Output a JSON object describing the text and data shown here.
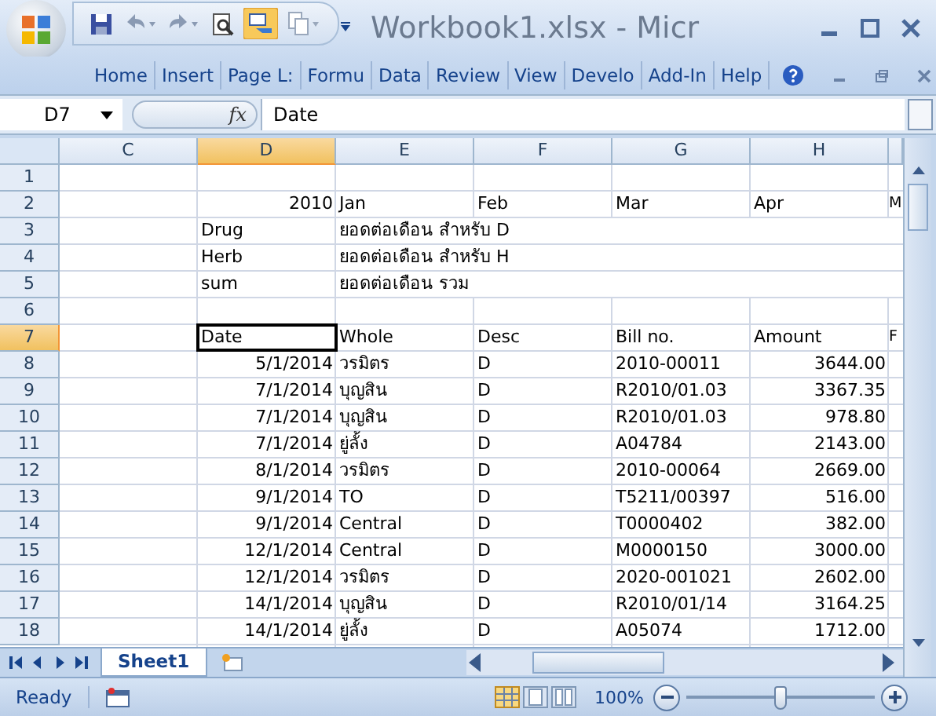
{
  "window": {
    "title": "Workbook1.xlsx - Micr"
  },
  "ribbon_tabs": [
    {
      "label": "Home",
      "selected": false
    },
    {
      "label": "Insert",
      "selected": false
    },
    {
      "label": "Page L:",
      "selected": false
    },
    {
      "label": "Formu",
      "selected": false
    },
    {
      "label": "Data",
      "selected": false
    },
    {
      "label": "Review",
      "selected": false
    },
    {
      "label": "View",
      "selected": false
    },
    {
      "label": "Develo",
      "selected": false
    },
    {
      "label": "Add-In",
      "selected": false
    },
    {
      "label": "Help",
      "selected": false
    }
  ],
  "formula_bar": {
    "name_box": "D7",
    "fx": "fx",
    "value": "Date"
  },
  "columns": [
    {
      "label": "C",
      "selected": false
    },
    {
      "label": "D",
      "selected": true
    },
    {
      "label": "E",
      "selected": false
    },
    {
      "label": "F",
      "selected": false
    },
    {
      "label": "G",
      "selected": false
    },
    {
      "label": "H",
      "selected": false
    }
  ],
  "rows": [
    {
      "number": "1",
      "selected": false,
      "cells": [
        null,
        null,
        null,
        null,
        null,
        null,
        null
      ]
    },
    {
      "number": "2",
      "selected": false,
      "cells": [
        null,
        {
          "text": "2010",
          "kind": "number"
        },
        {
          "text": "Jan",
          "kind": "text"
        },
        {
          "text": "Feb",
          "kind": "text"
        },
        {
          "text": "Mar",
          "kind": "text"
        },
        {
          "text": "Apr",
          "kind": "text"
        },
        {
          "text": "M",
          "kind": "text"
        }
      ]
    },
    {
      "number": "3",
      "selected": false,
      "cells": [
        null,
        {
          "text": "Drug",
          "kind": "text"
        },
        {
          "text": "ยอดต่อเดือน สำหรับ D",
          "kind": "text"
        },
        null,
        null,
        null,
        null
      ]
    },
    {
      "number": "4",
      "selected": false,
      "cells": [
        null,
        {
          "text": "Herb",
          "kind": "text"
        },
        {
          "text": "ยอดต่อเดือน สำหรับ H",
          "kind": "text"
        },
        null,
        null,
        null,
        null
      ]
    },
    {
      "number": "5",
      "selected": false,
      "cells": [
        null,
        {
          "text": "sum",
          "kind": "text"
        },
        {
          "text": "ยอดต่อเดือน รวม",
          "kind": "text"
        },
        null,
        null,
        null,
        null
      ]
    },
    {
      "number": "6",
      "selected": false,
      "cells": [
        null,
        null,
        null,
        null,
        null,
        null,
        null
      ]
    },
    {
      "number": "7",
      "selected": true,
      "cells": [
        null,
        {
          "text": "Date",
          "kind": "text"
        },
        {
          "text": "Whole",
          "kind": "text"
        },
        {
          "text": "Desc",
          "kind": "text"
        },
        {
          "text": "Bill no.",
          "kind": "text"
        },
        {
          "text": "Amount",
          "kind": "text"
        },
        {
          "text": "F",
          "kind": "text"
        }
      ]
    },
    {
      "number": "8",
      "selected": false,
      "cells": [
        null,
        {
          "text": "5/1/2014",
          "kind": "number"
        },
        {
          "text": "วรมิตร",
          "kind": "text"
        },
        {
          "text": "D",
          "kind": "text"
        },
        {
          "text": "2010-00011",
          "kind": "text"
        },
        {
          "text": "3644.00",
          "kind": "number"
        },
        null
      ]
    },
    {
      "number": "9",
      "selected": false,
      "cells": [
        null,
        {
          "text": "7/1/2014",
          "kind": "number"
        },
        {
          "text": "บุญสิน",
          "kind": "text"
        },
        {
          "text": "D",
          "kind": "text"
        },
        {
          "text": "R2010/01.03",
          "kind": "text"
        },
        {
          "text": "3367.35",
          "kind": "number"
        },
        null
      ]
    },
    {
      "number": "10",
      "selected": false,
      "cells": [
        null,
        {
          "text": "7/1/2014",
          "kind": "number"
        },
        {
          "text": "บุญสิน",
          "kind": "text"
        },
        {
          "text": "D",
          "kind": "text"
        },
        {
          "text": "R2010/01.03",
          "kind": "text"
        },
        {
          "text": "978.80",
          "kind": "number"
        },
        null
      ]
    },
    {
      "number": "11",
      "selected": false,
      "cells": [
        null,
        {
          "text": "7/1/2014",
          "kind": "number"
        },
        {
          "text": "ยู่ลั้ง",
          "kind": "text"
        },
        {
          "text": "D",
          "kind": "text"
        },
        {
          "text": "A04784",
          "kind": "text"
        },
        {
          "text": "2143.00",
          "kind": "number"
        },
        null
      ]
    },
    {
      "number": "12",
      "selected": false,
      "cells": [
        null,
        {
          "text": "8/1/2014",
          "kind": "number"
        },
        {
          "text": "วรมิตร",
          "kind": "text"
        },
        {
          "text": "D",
          "kind": "text"
        },
        {
          "text": "2010-00064",
          "kind": "text"
        },
        {
          "text": "2669.00",
          "kind": "number"
        },
        null
      ]
    },
    {
      "number": "13",
      "selected": false,
      "cells": [
        null,
        {
          "text": "9/1/2014",
          "kind": "number"
        },
        {
          "text": "TO",
          "kind": "text"
        },
        {
          "text": "D",
          "kind": "text"
        },
        {
          "text": "T5211/00397",
          "kind": "text"
        },
        {
          "text": "516.00",
          "kind": "number"
        },
        null
      ]
    },
    {
      "number": "14",
      "selected": false,
      "cells": [
        null,
        {
          "text": "9/1/2014",
          "kind": "number"
        },
        {
          "text": "Central",
          "kind": "text"
        },
        {
          "text": "D",
          "kind": "text"
        },
        {
          "text": "T0000402",
          "kind": "text"
        },
        {
          "text": "382.00",
          "kind": "number"
        },
        null
      ]
    },
    {
      "number": "15",
      "selected": false,
      "cells": [
        null,
        {
          "text": "12/1/2014",
          "kind": "number"
        },
        {
          "text": "Central",
          "kind": "text"
        },
        {
          "text": "D",
          "kind": "text"
        },
        {
          "text": "M0000150",
          "kind": "text"
        },
        {
          "text": "3000.00",
          "kind": "number"
        },
        null
      ]
    },
    {
      "number": "16",
      "selected": false,
      "cells": [
        null,
        {
          "text": "12/1/2014",
          "kind": "number"
        },
        {
          "text": "วรมิตร",
          "kind": "text"
        },
        {
          "text": "D",
          "kind": "text"
        },
        {
          "text": "2020-001021",
          "kind": "text"
        },
        {
          "text": "2602.00",
          "kind": "number"
        },
        null
      ]
    },
    {
      "number": "17",
      "selected": false,
      "cells": [
        null,
        {
          "text": "14/1/2014",
          "kind": "number"
        },
        {
          "text": "บุญสิน",
          "kind": "text"
        },
        {
          "text": "D",
          "kind": "text"
        },
        {
          "text": "R2010/01/14",
          "kind": "text"
        },
        {
          "text": "3164.25",
          "kind": "number"
        },
        null
      ]
    },
    {
      "number": "18",
      "selected": false,
      "cells": [
        null,
        {
          "text": "14/1/2014",
          "kind": "number"
        },
        {
          "text": "ยู่ลั้ง",
          "kind": "text"
        },
        {
          "text": "D",
          "kind": "text"
        },
        {
          "text": "A05074",
          "kind": "text"
        },
        {
          "text": "1712.00",
          "kind": "number"
        },
        null
      ]
    }
  ],
  "sheet_tabs": [
    {
      "label": "Sheet1",
      "selected": true
    }
  ],
  "status_bar": {
    "status": "Ready",
    "zoom": "100%",
    "zoom_level": {
      "level": 0.5
    }
  }
}
